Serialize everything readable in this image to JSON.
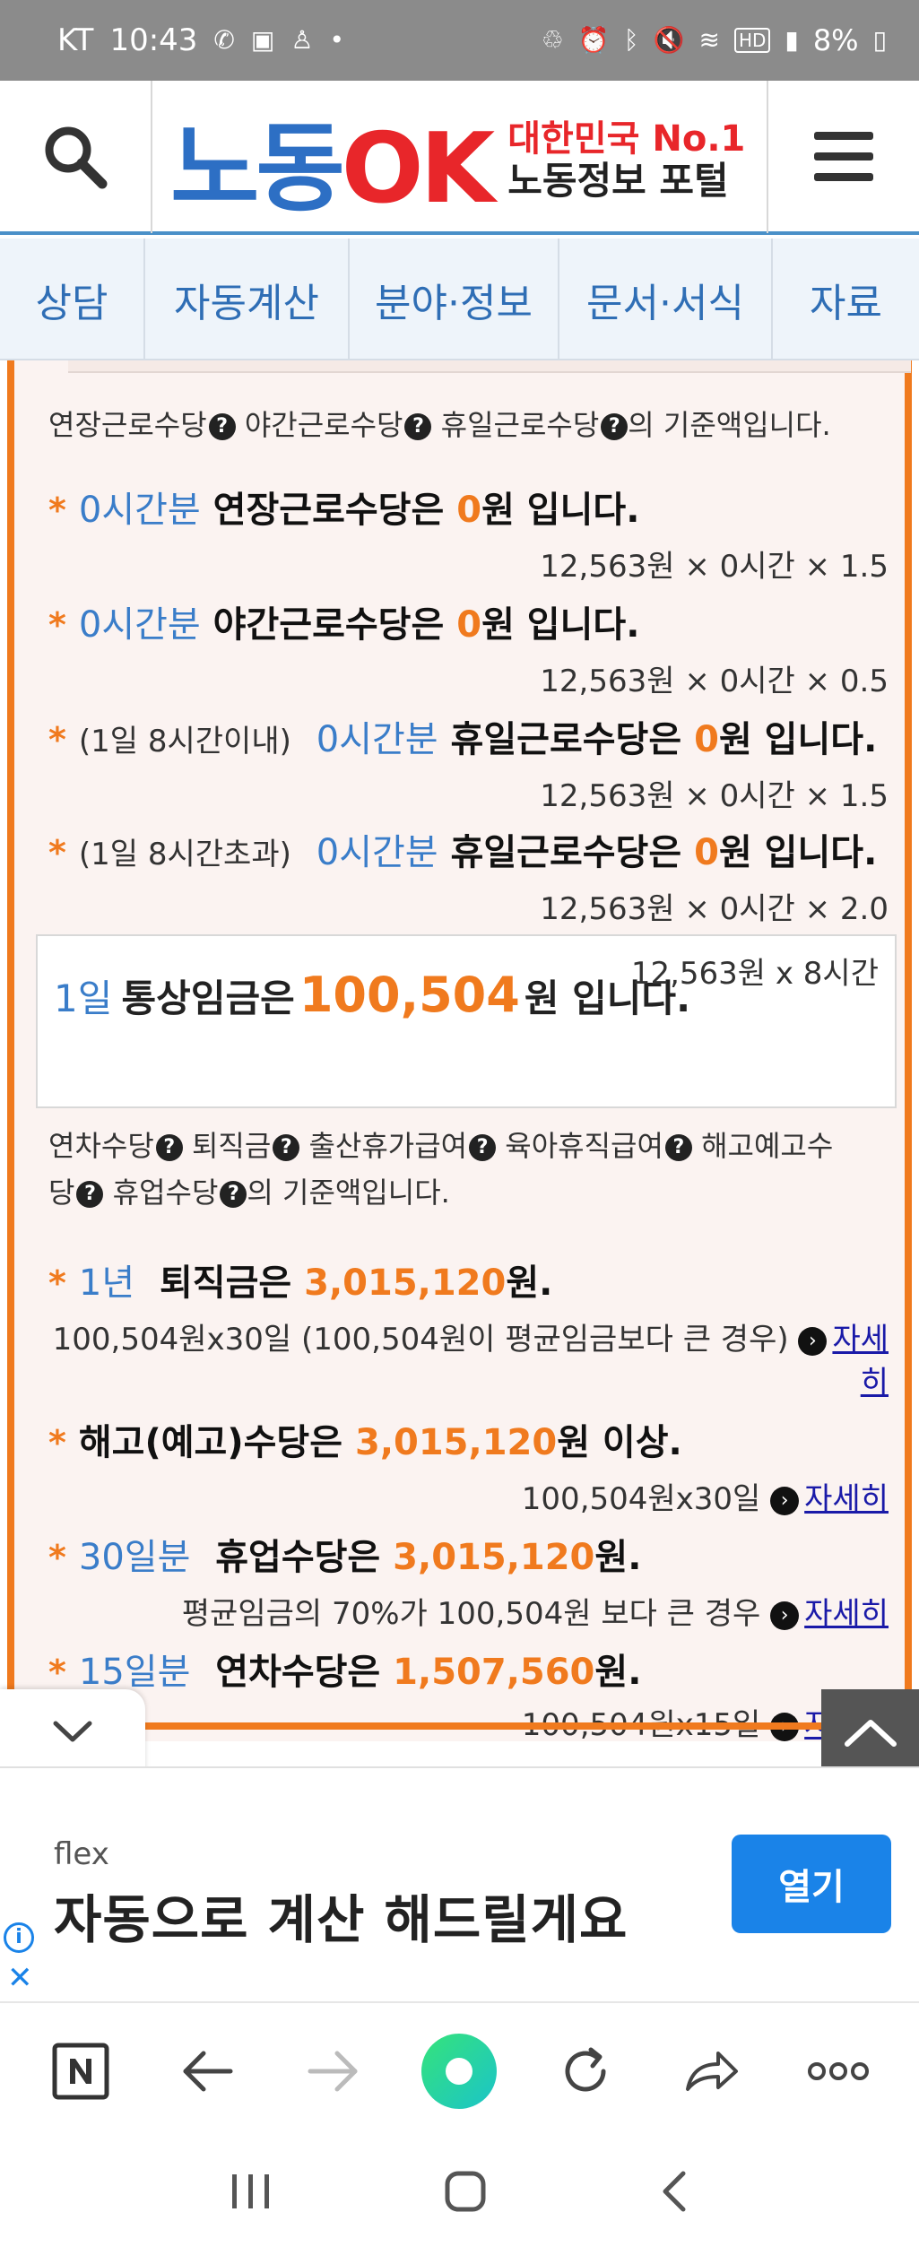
{
  "status_bar": {
    "carrier": "KT",
    "time": "10:43",
    "battery": "8%",
    "hd_label": "HD"
  },
  "header": {
    "logo_main_a": "노동",
    "logo_main_b": "OK",
    "logo_sub1": "대한민국 No.1",
    "logo_sub2": "노동정보 포털"
  },
  "nav": {
    "tabs": [
      {
        "label": "상담"
      },
      {
        "label": "자동계산"
      },
      {
        "label": "분야·정보"
      },
      {
        "label": "문서·서식"
      },
      {
        "label": "자료"
      }
    ]
  },
  "section1": {
    "intro_a": "연장근로수당",
    "intro_b": " 야간근로수당",
    "intro_c": " 휴일근로수당",
    "intro_d": "의 기준액입니다.",
    "items": [
      {
        "prefix": "",
        "hours": "0시간분",
        "label": "연장근로수당은",
        "amount": "0",
        "suffix": "원 입니다.",
        "formula": "12,563원 × 0시간 × 1.5"
      },
      {
        "prefix": "",
        "hours": "0시간분",
        "label": "야간근로수당은",
        "amount": "0",
        "suffix": "원 입니다.",
        "formula": "12,563원 × 0시간 × 0.5"
      },
      {
        "prefix": "(1일 8시간이내)",
        "hours": "0시간분",
        "label": "휴일근로수당은",
        "amount": "0",
        "suffix": "원 입니다.",
        "formula": "12,563원 × 0시간 × 1.5"
      },
      {
        "prefix": "(1일 8시간초과)",
        "hours": "0시간분",
        "label": "휴일근로수당은",
        "amount": "0",
        "suffix": "원 입니다.",
        "formula": "12,563원 × 0시간 × 2.0"
      }
    ]
  },
  "daily_wage": {
    "days": "1일",
    "label": "통상임금은",
    "amount": "100,504",
    "suffix": "원 입니다.",
    "formula": "12,563원 x 8시간"
  },
  "section2": {
    "intro_a": "연차수당",
    "intro_b": " 퇴직금",
    "intro_c": " 출산휴가급여",
    "intro_d": " 육아휴직급여",
    "intro_e": " 해고예고수",
    "intro_f": "당",
    "intro_g": " 휴업수당",
    "intro_h": "의 기준액입니다.",
    "severance": {
      "years": "1년",
      "label": "퇴직금은",
      "amount": "3,015,120",
      "suffix": "원.",
      "formula": "100,504원x30일 (100,504원이 평균임금보다 큰 경우)",
      "link_a": "자세",
      "link_b": "히"
    },
    "dismissal": {
      "label": "해고(예고)수당은",
      "amount": "3,015,120",
      "suffix": "원 이상.",
      "formula": "100,504원x30일",
      "link": "자세히"
    },
    "shutdown": {
      "days": "30일분",
      "label": "휴업수당은",
      "amount": "3,015,120",
      "suffix": "원.",
      "formula": "평균임금의 70%가 100,504원 보다 큰 경우",
      "link": "자세히"
    },
    "annual": {
      "days": "15일분",
      "label": "연차수당은",
      "amount": "1,507,560",
      "suffix": "원.",
      "formula": "100,504원x15일",
      "link": "자세히"
    }
  },
  "ad": {
    "brand": "flex",
    "text": "자동으로 계산 해드릴게요",
    "button": "열기",
    "info": "i",
    "close": "✕"
  },
  "star": "*",
  "qmark": "?",
  "arrow": "›",
  "colors": {
    "accent_orange": "#f07a1e",
    "nav_blue": "#2f6eb5",
    "ad_blue": "#1a83e8"
  }
}
